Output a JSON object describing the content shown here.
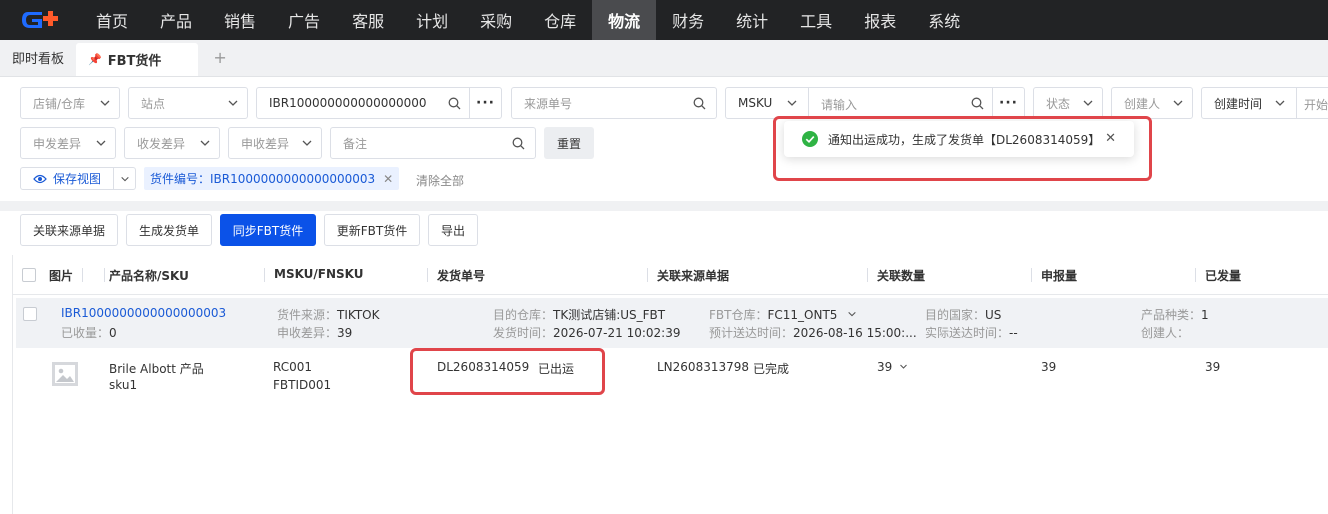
{
  "nav": {
    "items": [
      "首页",
      "产品",
      "销售",
      "广告",
      "客服",
      "计划",
      "采购",
      "仓库",
      "物流",
      "财务",
      "统计",
      "工具",
      "报表",
      "系统"
    ],
    "active_index": 8
  },
  "tabs": {
    "board": "即时看板",
    "current": "FBT货件",
    "add": "+"
  },
  "filters": {
    "shop_warehouse": "店铺/仓库",
    "site": "站点",
    "shipment_no_value": "IBR100000000000000000",
    "source_no_placeholder": "来源单号",
    "msku_select": "MSKU",
    "msku_placeholder": "请输入",
    "status": "状态",
    "creator": "创建人",
    "create_time": "创建时间",
    "start_placeholder": "开始",
    "declare_diff": "申发差异",
    "receive_diff": "收发差异",
    "apply_receive_diff": "申收差异",
    "remark_placeholder": "备注",
    "reset": "重置",
    "save_view": "保存视图",
    "chip": "货件编号：IBR1000000000000000003",
    "clear_all": "清除全部"
  },
  "actions": {
    "link_source": "关联来源单据",
    "gen_shipment": "生成发货单",
    "sync_fbt": "同步FBT货件",
    "update_fbt": "更新FBT货件",
    "export": "导出"
  },
  "table": {
    "headers": [
      "图片",
      "产品名称/SKU",
      "MSKU/FNSKU",
      "发货单号",
      "关联来源单据",
      "关联数量",
      "申报量",
      "已发量"
    ],
    "group": {
      "shipment_id": "IBR1000000000000000003",
      "received_label": "已收量：",
      "received": "0",
      "source_label": "货件来源：",
      "source": "TIKTOK",
      "apply_diff_label": "申收差异：",
      "apply_diff": "39",
      "dest_wh_label": "目的仓库：",
      "dest_wh": "TK测试店铺:US_FBT",
      "ship_time_label": "发货时间：",
      "ship_time": "2026-07-21 10:02:39",
      "fbt_wh_label": "FBT仓库：",
      "fbt_wh": "FC11_ONT5",
      "eta_label": "预计送达时间：",
      "eta": "2026-08-16 15:00:...",
      "dest_country_label": "目的国家：",
      "dest_country": "US",
      "actual_label": "实际送达时间：",
      "actual": "--",
      "category_label": "产品种类：",
      "category": "1",
      "creator_label": "创建人："
    },
    "row": {
      "product_name": "Brile Albott 产品",
      "sku": "sku1",
      "msku": "RC001",
      "fnsku": "FBTID001",
      "shipment_no": "DL2608314059",
      "shipment_status": "已出运",
      "source_no": "LN2608313798",
      "source_status": "已完成",
      "linked_qty": "39",
      "declared": "39",
      "shipped": "39"
    }
  },
  "toast": {
    "message": "通知出运成功，生成了发货单【DL2608314059】",
    "close": "✕"
  },
  "colors": {
    "primary": "#0b52e8",
    "link": "#1a5ad6",
    "success": "#2fb344",
    "highlight": "#e0454a"
  }
}
